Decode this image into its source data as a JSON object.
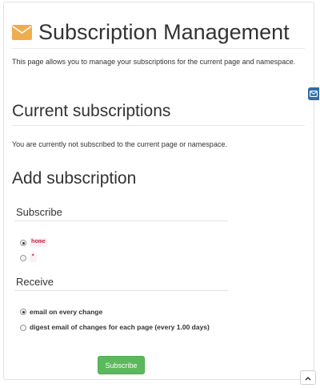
{
  "page": {
    "title": "Subscription Management",
    "intro": "This page allows you to manage your subscriptions for the current page and namespace."
  },
  "current": {
    "heading": "Current subscriptions",
    "message": "You are currently not subscribed to the current page or namespace."
  },
  "add": {
    "heading": "Add subscription",
    "subscribe": {
      "legend": "Subscribe",
      "options": [
        {
          "label": "home",
          "checked": true
        },
        {
          "label": "*",
          "checked": false
        }
      ]
    },
    "receive": {
      "legend": "Receive",
      "options": [
        {
          "label": "email on every change",
          "checked": true
        },
        {
          "label": "digest email of changes for each page (every 1.00 days)",
          "checked": false
        }
      ]
    },
    "submit_label": "Subscribe"
  },
  "colors": {
    "accent_icon": "#f0ad4e",
    "button_green": "#5cb85c",
    "side_tab_blue": "#2e6da4",
    "code_red": "#c7254e"
  },
  "icons": {
    "title": "envelope-icon",
    "side_tab": "envelope-outline-icon",
    "scroll_top": "chevron-up-icon"
  }
}
